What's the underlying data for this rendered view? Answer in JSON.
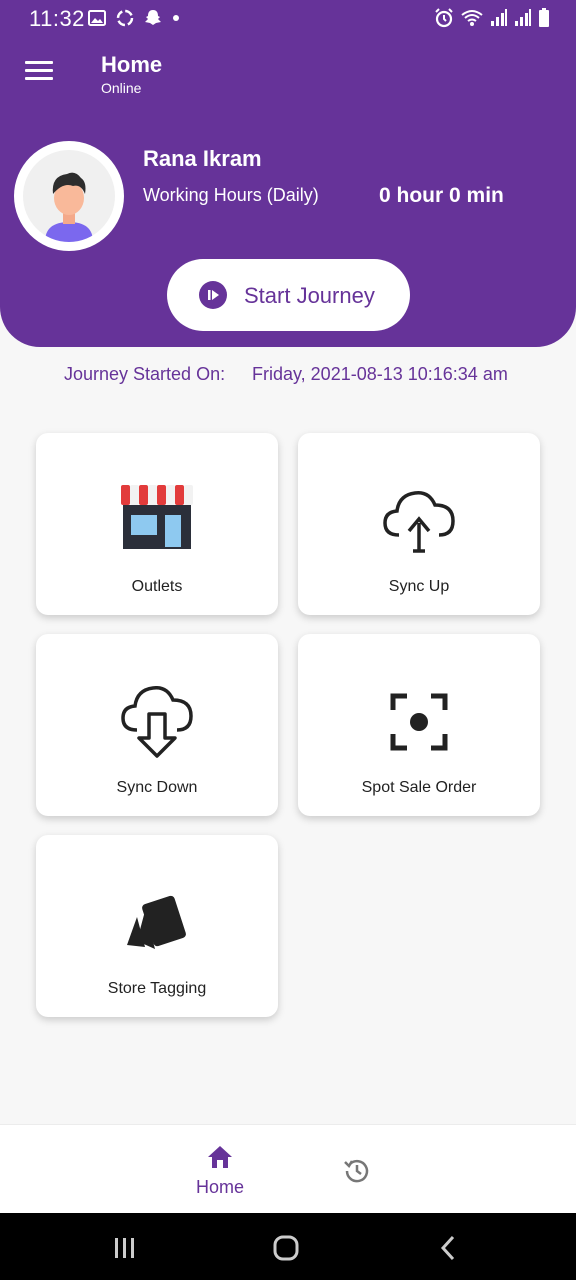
{
  "status_bar": {
    "time": "11:32",
    "left_icons": [
      "image-icon",
      "sync-icon",
      "snapchat-icon",
      "dot-icon"
    ],
    "right_icons": [
      "alarm-icon",
      "wifi-icon",
      "signal-icon",
      "signal-icon",
      "battery-icon"
    ]
  },
  "app_bar": {
    "title": "Home",
    "subtitle": "Online",
    "menu_icon": "hamburger-menu-icon"
  },
  "profile": {
    "name": "Rana Ikram",
    "working_hours_label": "Working Hours (Daily)",
    "working_hours_value": "0 hour 0 min",
    "avatar_icon": "user-avatar-icon"
  },
  "start_button": {
    "label": "Start Journey",
    "icon": "play-icon"
  },
  "journey": {
    "label": "Journey Started On:",
    "value": "Friday, 2021-08-13 10:16:34 am"
  },
  "tiles": [
    {
      "label": "Outlets",
      "icon": "store-icon"
    },
    {
      "label": "Sync Up",
      "icon": "cloud-upload-icon"
    },
    {
      "label": "Sync Down",
      "icon": "cloud-download-icon"
    },
    {
      "label": "Spot Sale Order",
      "icon": "focus-scan-icon"
    },
    {
      "label": "Store Tagging",
      "icon": "tags-icon"
    }
  ],
  "bottom_nav": {
    "home_label": "Home",
    "home_icon": "home-icon",
    "history_icon": "history-icon"
  },
  "colors": {
    "primary": "#663399",
    "background": "#f7f7f7",
    "card": "#ffffff"
  }
}
